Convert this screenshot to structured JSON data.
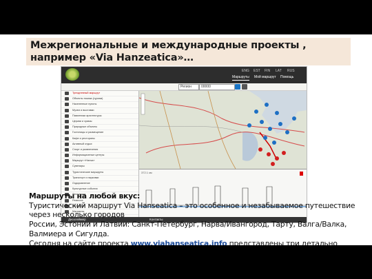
{
  "slide": {
    "title": "Межрегиональные и международные проекты , например «Via Hanzeatica»…"
  },
  "screenshot": {
    "brand": "Via Hanzeatica",
    "lang_items": [
      "ENG",
      "EST",
      "FIN",
      "LAT",
      "RUS"
    ],
    "nav_items": [
      "Маршруты",
      "Мой маршрут",
      "Помощь"
    ],
    "toolbar": {
      "region_select": "Регион",
      "search_value": "00000"
    },
    "panel_items": [
      "Трехдневный маршрут",
      "Объекты показа (туризм)",
      "Населенные пункты",
      "Музеи и выставки",
      "Памятники архитектуры",
      "Церкви и храмы",
      "Природные объекты",
      "Гостиницы и размещение",
      "Кафе и рестораны",
      "Активный отдых",
      "Спорт и развлечения",
      "Информационные центры",
      "Маршрут «Hansa»",
      "Сувениры",
      "Туристические маршруты",
      "Транспорт и парковки",
      "Оздоровление",
      "Культурные события",
      "Фестивали",
      "Ремесла",
      "Экскурсии",
      "Магазины"
    ],
    "profile_label": "372.1 км",
    "footer": {
      "left": "Дисклеймер",
      "right": "Контакты"
    }
  },
  "caption": {
    "heading": "Маршруты на любой вкус:",
    "line1": "Туристический маршрут Via Hanseatica – это особенное и незабываемое путешествие через несколько городов",
    "line2": " России, Эстонии и Латвии: Санкт-Петербург, Нарва/Ивангород, Тарту, Валга/Валка, Валмиера и Сигулда.",
    "line3_pre": "Сегодня на сайте проекта ",
    "link": "www.viahanseatica.info",
    "line3_post": " представлены три детально проработанные маршрута"
  }
}
